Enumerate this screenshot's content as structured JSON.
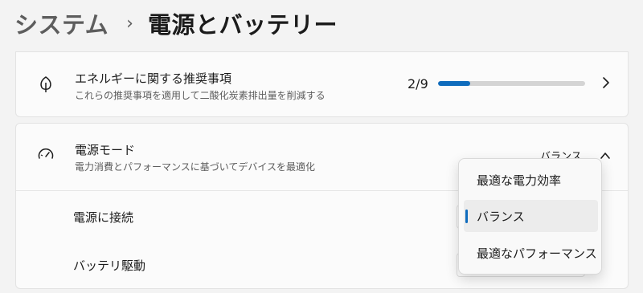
{
  "breadcrumb": {
    "parent": "システム",
    "separator": "›",
    "current": "電源とバッテリー"
  },
  "energy_card": {
    "icon": "leaf-icon",
    "title": "エネルギーに関する推奨事項",
    "subtitle": "これらの推奨事項を適用して二酸化炭素排出量を削減する",
    "progress_text": "2/9",
    "progress_fraction": 0.22,
    "chevron": "chevron-right-icon"
  },
  "power_mode": {
    "icon": "speedometer-icon",
    "title": "電源モード",
    "subtitle": "電力消費とパフォーマンスに基づいてデバイスを最適化",
    "current_value": "バランス",
    "chevron": "chevron-up-icon",
    "rows": [
      {
        "label": "電源に接続"
      },
      {
        "label": "バッテリ駆動"
      }
    ]
  },
  "flyout": {
    "items": [
      {
        "label": "最適な電力効率",
        "selected": false
      },
      {
        "label": "バランス",
        "selected": true
      },
      {
        "label": "最適なパフォーマンス",
        "selected": false
      }
    ]
  },
  "colors": {
    "accent": "#0f6cbd",
    "background": "#f3f3f3",
    "card": "#fbfbfb"
  }
}
